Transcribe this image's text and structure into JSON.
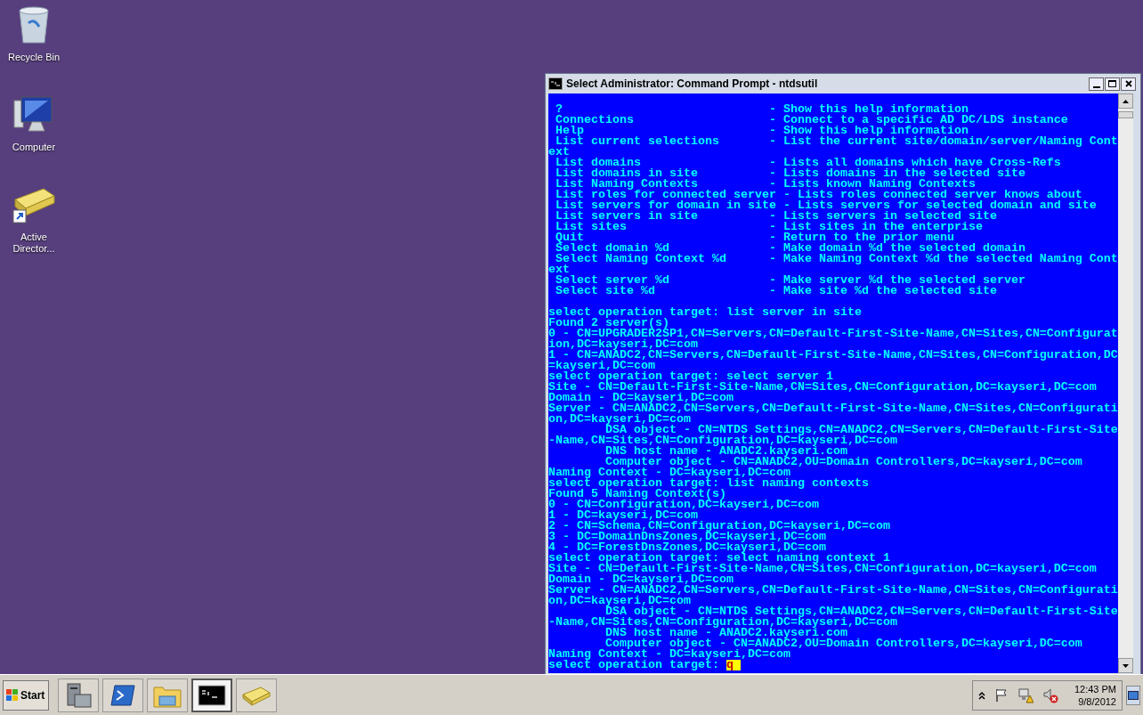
{
  "desktop_icons": [
    {
      "label": "Recycle Bin",
      "kind": "recycle-bin"
    },
    {
      "label": "Computer",
      "kind": "computer"
    },
    {
      "label": "Active Director...",
      "kind": "directory-shortcut"
    }
  ],
  "window": {
    "title": "Select Administrator: Command Prompt - ntdsutil",
    "console": {
      "blocks": [
        [
          " ?                             - Show this help information",
          " Connections                   - Connect to a specific AD DC/LDS instance",
          " Help                          - Show this help information",
          " List current selections       - List the current site/domain/server/Naming Cont",
          "ext",
          " List domains                  - Lists all domains which have Cross-Refs",
          " List domains in site          - Lists domains in the selected site",
          " List Naming Contexts          - Lists known Naming Contexts",
          " List roles for connected server - Lists roles connected server knows about",
          " List servers for domain in site - Lists servers for selected domain and site",
          " List servers in site          - Lists servers in selected site",
          " List sites                    - List sites in the enterprise",
          " Quit                          - Return to the prior menu",
          " Select domain %d              - Make domain %d the selected domain",
          " Select Naming Context %d      - Make Naming Context %d the selected Naming Cont",
          "ext",
          " Select server %d              - Make server %d the selected server",
          " Select site %d                - Make site %d the selected site"
        ],
        [
          "select operation target: list server in site",
          "Found 2 server(s)",
          "0 - CN=UPGRADER2SP1,CN=Servers,CN=Default-First-Site-Name,CN=Sites,CN=Configurat",
          "ion,DC=kayseri,DC=com",
          "1 - CN=ANADC2,CN=Servers,CN=Default-First-Site-Name,CN=Sites,CN=Configuration,DC",
          "=kayseri,DC=com",
          "select operation target: select server 1",
          "Site - CN=Default-First-Site-Name,CN=Sites,CN=Configuration,DC=kayseri,DC=com",
          "Domain - DC=kayseri,DC=com",
          "Server - CN=ANADC2,CN=Servers,CN=Default-First-Site-Name,CN=Sites,CN=Configurati",
          "on,DC=kayseri,DC=com",
          "        DSA object - CN=NTDS Settings,CN=ANADC2,CN=Servers,CN=Default-First-Site",
          "-Name,CN=Sites,CN=Configuration,DC=kayseri,DC=com",
          "        DNS host name - ANADC2.kayseri.com",
          "        Computer object - CN=ANADC2,OU=Domain Controllers,DC=kayseri,DC=com",
          "Naming Context - DC=kayseri,DC=com",
          "select operation target: list naming contexts",
          "Found 5 Naming Context(s)",
          "0 - CN=Configuration,DC=kayseri,DC=com",
          "1 - DC=kayseri,DC=com",
          "2 - CN=Schema,CN=Configuration,DC=kayseri,DC=com",
          "3 - DC=DomainDnsZones,DC=kayseri,DC=com",
          "4 - DC=ForestDnsZones,DC=kayseri,DC=com",
          "select operation target: select naming context 1",
          "Site - CN=Default-First-Site-Name,CN=Sites,CN=Configuration,DC=kayseri,DC=com",
          "Domain - DC=kayseri,DC=com",
          "Server - CN=ANADC2,CN=Servers,CN=Default-First-Site-Name,CN=Sites,CN=Configurati",
          "on,DC=kayseri,DC=com",
          "        DSA object - CN=NTDS Settings,CN=ANADC2,CN=Servers,CN=Default-First-Site",
          "-Name,CN=Sites,CN=Configuration,DC=kayseri,DC=com",
          "        DNS host name - ANADC2.kayseri.com",
          "        Computer object - CN=ANADC2,OU=Domain Controllers,DC=kayseri,DC=com",
          "Naming Context - DC=kayseri,DC=com"
        ]
      ],
      "prompt": "select operation target: ",
      "input": "q"
    }
  },
  "taskbar": {
    "start_label": "Start",
    "apps": [
      {
        "kind": "server-manager",
        "selected": false
      },
      {
        "kind": "powershell",
        "selected": false
      },
      {
        "kind": "explorer",
        "selected": false
      },
      {
        "kind": "console",
        "selected": true
      },
      {
        "kind": "directory",
        "selected": false
      }
    ],
    "tray": [
      {
        "kind": "chevron"
      },
      {
        "kind": "flag"
      },
      {
        "kind": "network"
      },
      {
        "kind": "speaker-muted"
      }
    ],
    "clock": {
      "time": "12:43 PM",
      "date": "9/8/2012"
    }
  }
}
